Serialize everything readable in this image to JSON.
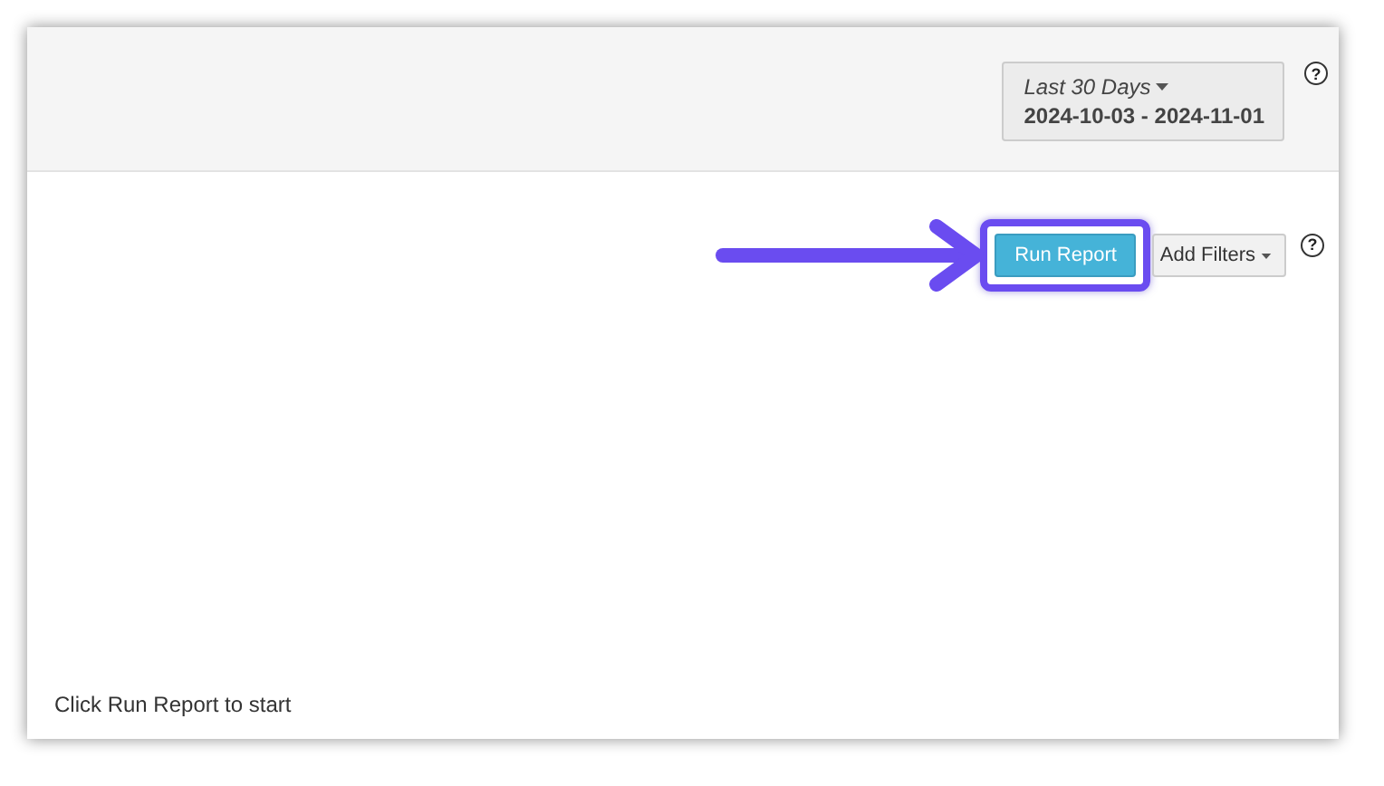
{
  "date_range": {
    "label": "Last 30 Days",
    "range": "2024-10-03 - 2024-11-01",
    "help": "?"
  },
  "toolbar": {
    "run_button": "Run Report",
    "filters_button": "Add Filters",
    "help": "?",
    "highlighted": true
  },
  "message": "Click Run Report to start"
}
